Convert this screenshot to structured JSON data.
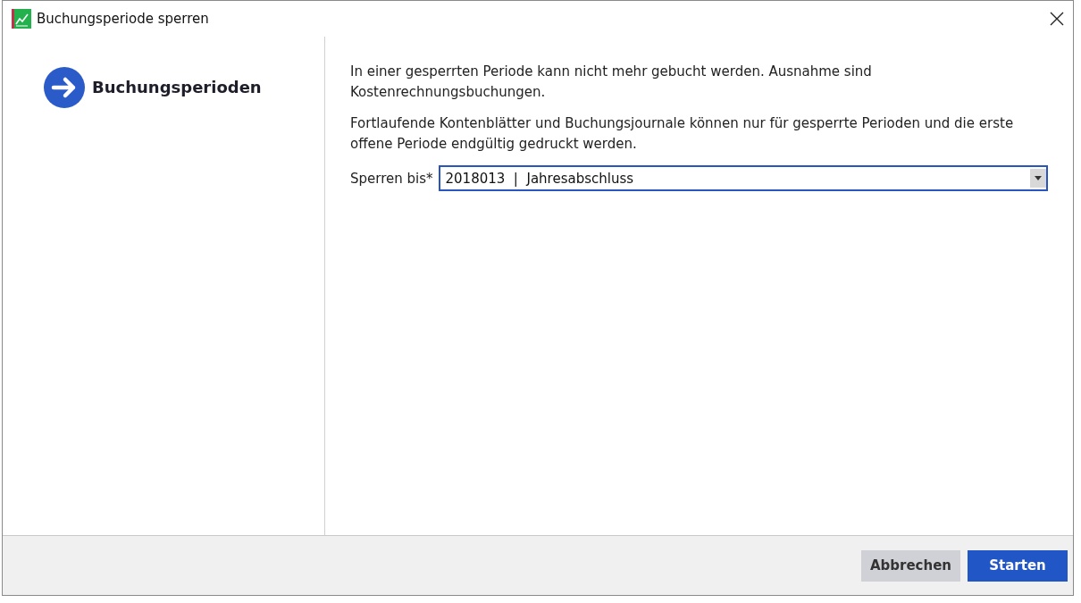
{
  "window": {
    "title": "Buchungsperiode sperren"
  },
  "step": {
    "label": "Buchungsperioden"
  },
  "paragraphs": [
    "In einer gesperrten Periode kann nicht mehr gebucht werden. Ausnahme sind Kostenrechnungsbuchungen.",
    "Fortlaufende Kontenblätter und Buchungsjournale können nur für gesperrte Perioden und die erste offene Periode endgültig gedruckt werden."
  ],
  "field": {
    "label": "Sperren bis*",
    "value": "2018013  |  Jahresabschluss"
  },
  "buttons": [
    {
      "label": "Abbrechen",
      "kind": "secondary"
    },
    {
      "label": "Starten",
      "kind": "primary"
    }
  ]
}
